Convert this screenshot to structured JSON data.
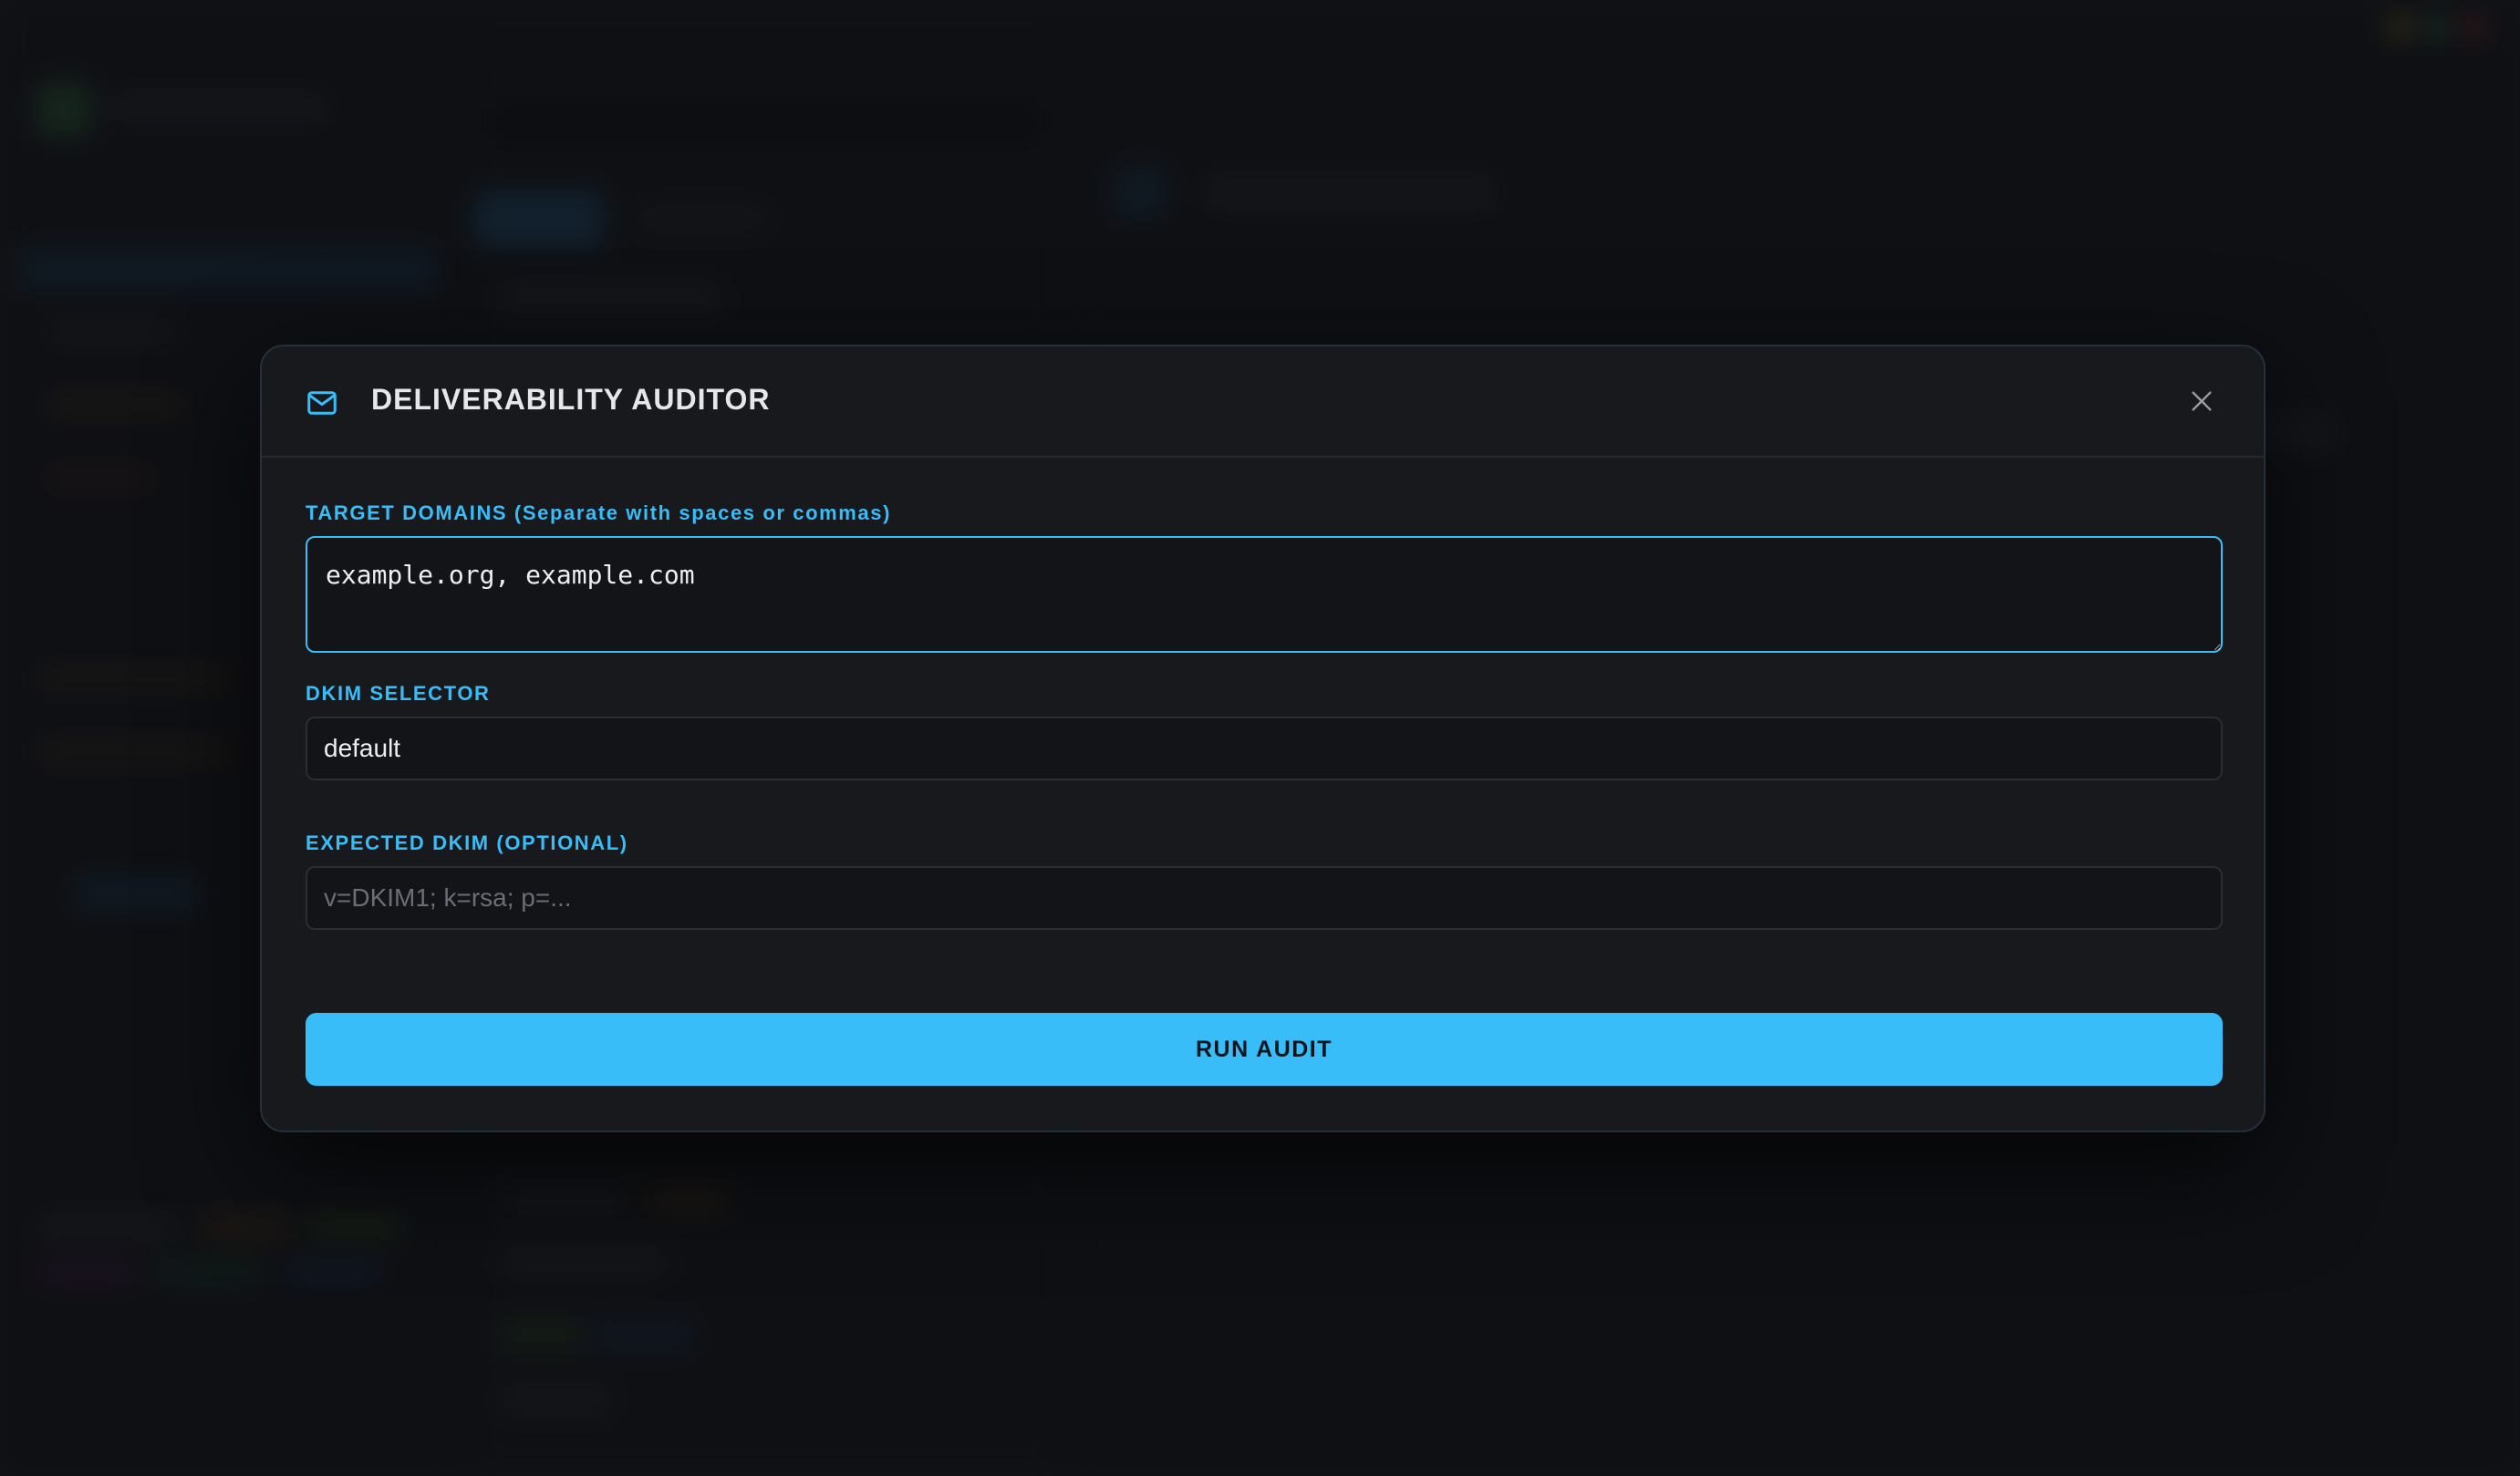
{
  "modal": {
    "title": "DELIVERABILITY AUDITOR",
    "header_icon": "mail-icon",
    "close_icon": "close-icon",
    "accent_color": "#38bdf8"
  },
  "fields": {
    "domains": {
      "label": "TARGET DOMAINS (Separate with spaces or commas)",
      "value": "example.org, example.com"
    },
    "dkim_selector": {
      "label": "DKIM SELECTOR",
      "value": "default"
    },
    "expected_dkim": {
      "label": "EXPECTED DKIM (OPTIONAL)",
      "value": "",
      "placeholder": "v=DKIM1; k=rsa; p=..."
    }
  },
  "actions": {
    "run_label": "RUN AUDIT"
  }
}
